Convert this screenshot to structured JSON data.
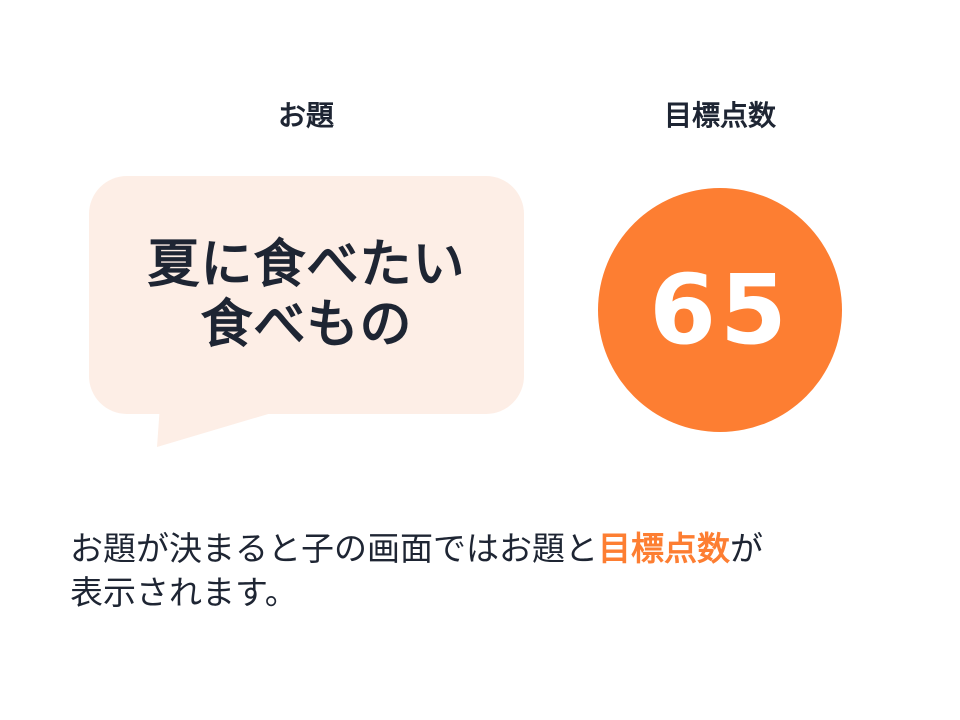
{
  "labels": {
    "topic": "お題",
    "target_score": "目標点数"
  },
  "topic_bubble": {
    "line1": "夏に食べたい",
    "line2": "食べもの"
  },
  "score": {
    "value": "65"
  },
  "caption": {
    "part1": "お題が決まると子の画面ではお題と",
    "highlight": "目標点数",
    "part2": "が",
    "line2": "表示されます。"
  },
  "colors": {
    "accent": "#fd7e32",
    "bubble_bg": "#fdeee6",
    "text": "#1e2533"
  }
}
